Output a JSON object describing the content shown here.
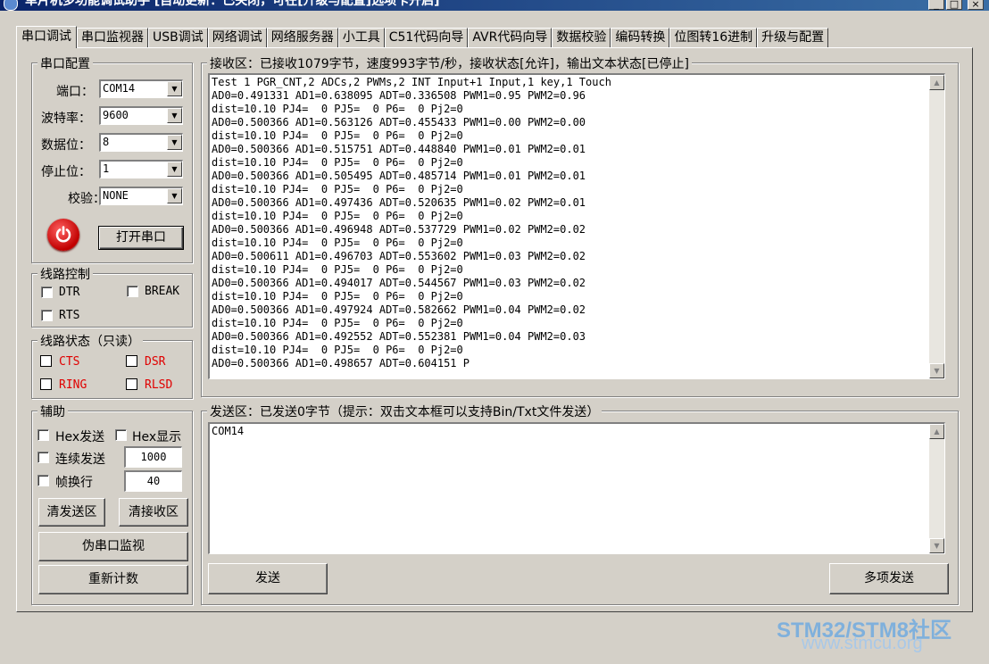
{
  "window": {
    "title": "单片机多功能调试助手 [自动更新：已关闭，可在[升级与配置]选项卡开启]",
    "minimize": "_",
    "maximize": "□",
    "close": "×"
  },
  "tabs": [
    {
      "label": "串口调试",
      "active": true
    },
    {
      "label": "串口监视器"
    },
    {
      "label": "USB调试"
    },
    {
      "label": "网络调试"
    },
    {
      "label": "网络服务器"
    },
    {
      "label": "小工具"
    },
    {
      "label": "C51代码向导"
    },
    {
      "label": "AVR代码向导"
    },
    {
      "label": "数据校验"
    },
    {
      "label": "编码转换"
    },
    {
      "label": "位图转16进制"
    },
    {
      "label": "升级与配置"
    }
  ],
  "serial_config": {
    "title": "串口配置",
    "port_label": "端口：",
    "port_value": "COM14",
    "baud_label": "波特率：",
    "baud_value": "9600",
    "databits_label": "数据位：",
    "databits_value": "8",
    "stopbits_label": "停止位：",
    "stopbits_value": "1",
    "parity_label": "校验：",
    "parity_value": "NONE",
    "open_button": "打开串口",
    "power_icon": "power-icon"
  },
  "line_control": {
    "title": "线路控制",
    "dtr": "DTR",
    "break": "BREAK",
    "rts": "RTS"
  },
  "line_status": {
    "title": "线路状态（只读）",
    "cts": "CTS",
    "dsr": "DSR",
    "ring": "RING",
    "rlsd": "RLSD",
    "status_color": "#e00000"
  },
  "assist": {
    "title": "辅助",
    "hex_send": "Hex发送",
    "hex_display": "Hex显示",
    "continuous_send": "连续发送",
    "continuous_interval": "1000",
    "frame_newline": "帧换行",
    "frame_value": "40",
    "clear_send": "清发送区",
    "clear_receive": "清接收区",
    "pseudo_monitor": "伪串口监视",
    "recount": "重新计数"
  },
  "receive": {
    "title": "接收区：已接收1079字节，速度993字节/秒，接收状态[允许]，输出文本状态[已停止]",
    "lines": [
      "Test 1 PGR_CNT,2 ADCs,2 PWMs,2 INT Input+1 Input,1 key,1 Touch",
      "AD0=0.491331 AD1=0.638095 ADT=0.336508 PWM1=0.95 PWM2=0.96",
      "dist=10.10 PJ4=  0 PJ5=  0 P6=  0 Pj2=0",
      "AD0=0.500366 AD1=0.563126 ADT=0.455433 PWM1=0.00 PWM2=0.00",
      "dist=10.10 PJ4=  0 PJ5=  0 P6=  0 Pj2=0",
      "AD0=0.500366 AD1=0.515751 ADT=0.448840 PWM1=0.01 PWM2=0.01",
      "dist=10.10 PJ4=  0 PJ5=  0 P6=  0 Pj2=0",
      "AD0=0.500366 AD1=0.505495 ADT=0.485714 PWM1=0.01 PWM2=0.01",
      "dist=10.10 PJ4=  0 PJ5=  0 P6=  0 Pj2=0",
      "AD0=0.500366 AD1=0.497436 ADT=0.520635 PWM1=0.02 PWM2=0.01",
      "dist=10.10 PJ4=  0 PJ5=  0 P6=  0 Pj2=0",
      "AD0=0.500366 AD1=0.496948 ADT=0.537729 PWM1=0.02 PWM2=0.02",
      "dist=10.10 PJ4=  0 PJ5=  0 P6=  0 Pj2=0",
      "AD0=0.500611 AD1=0.496703 ADT=0.553602 PWM1=0.03 PWM2=0.02",
      "dist=10.10 PJ4=  0 PJ5=  0 P6=  0 Pj2=0",
      "AD0=0.500366 AD1=0.494017 ADT=0.544567 PWM1=0.03 PWM2=0.02",
      "dist=10.10 PJ4=  0 PJ5=  0 P6=  0 Pj2=0",
      "AD0=0.500366 AD1=0.497924 ADT=0.582662 PWM1=0.04 PWM2=0.02",
      "dist=10.10 PJ4=  0 PJ5=  0 P6=  0 Pj2=0",
      "AD0=0.500366 AD1=0.492552 ADT=0.552381 PWM1=0.04 PWM2=0.03",
      "dist=10.10 PJ4=  0 PJ5=  0 P6=  0 Pj2=0",
      "AD0=0.500366 AD1=0.498657 ADT=0.604151 P"
    ]
  },
  "send": {
    "title": "发送区：已发送0字节（提示：双击文本框可以支持Bin/Txt文件发送）",
    "text": "COM14",
    "send_button": "发送",
    "multi_send_button": "多项发送"
  },
  "watermark": {
    "line1": "STM32/STM8社区",
    "line2": "www.stmcu.org"
  }
}
